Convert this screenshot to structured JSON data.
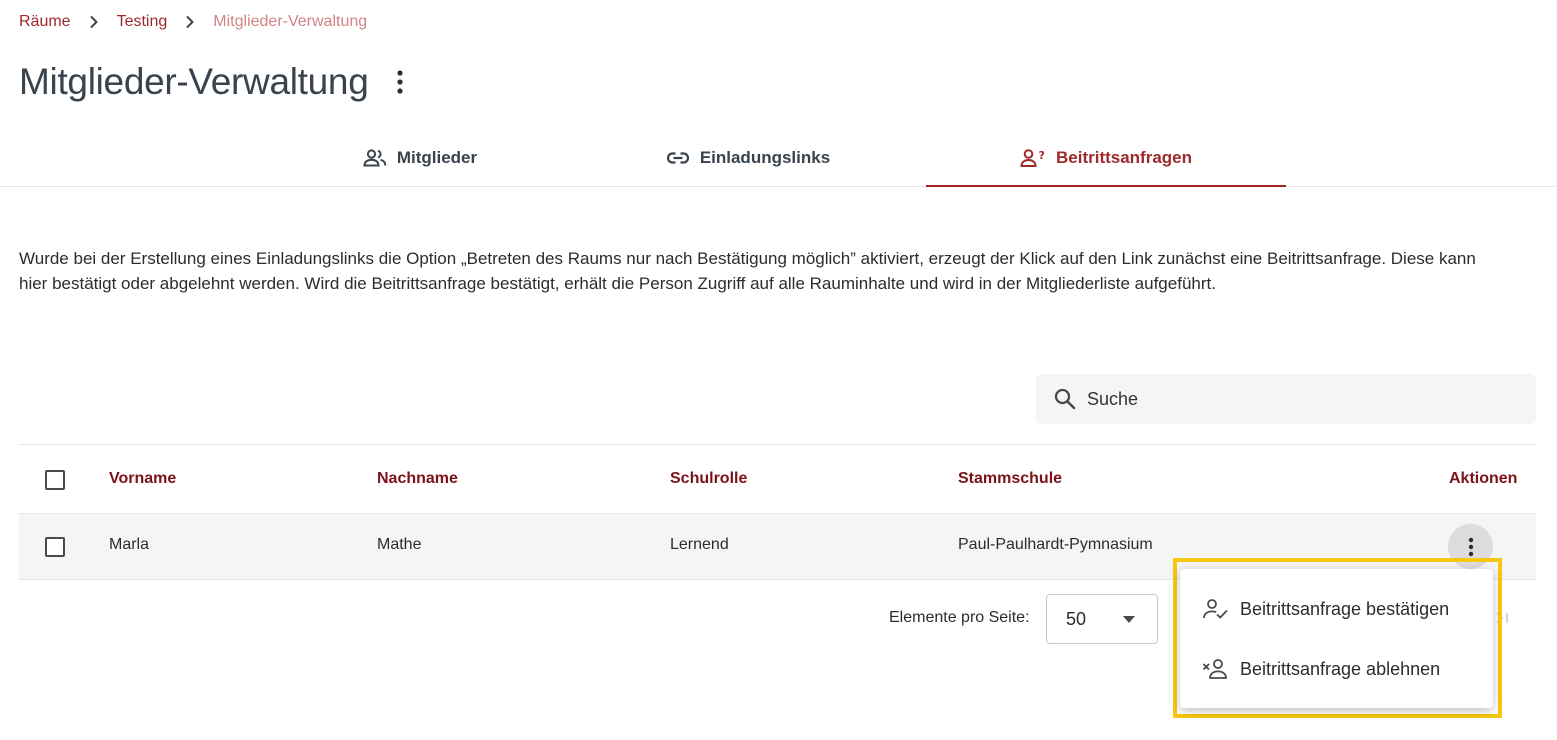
{
  "breadcrumb": {
    "items": [
      "Räume",
      "Testing",
      "Mitglieder-Verwaltung"
    ]
  },
  "page": {
    "title": "Mitglieder-Verwaltung"
  },
  "tabs": [
    {
      "label": "Mitglieder",
      "icon": "people-icon",
      "active": false
    },
    {
      "label": "Einladungslinks",
      "icon": "link-icon",
      "active": false
    },
    {
      "label": "Beitrittsanfragen",
      "icon": "person-question-icon",
      "active": true
    }
  ],
  "info": {
    "text": "Wurde bei der Erstellung eines Einladungslinks die Option „Betreten des Raums nur nach Bestätigung möglich” aktiviert, erzeugt der Klick auf den Link zunächst eine Beitrittsanfrage. Diese kann hier bestätigt oder abgelehnt werden. Wird die Beitrittsanfrage bestätigt, erhält die Person Zugriff auf alle Rauminhalte und wird in der Mitgliederliste aufgeführt."
  },
  "search": {
    "placeholder": "Suche"
  },
  "table": {
    "columns": [
      "Vorname",
      "Nachname",
      "Schulrolle",
      "Stammschule",
      "Aktionen"
    ],
    "rows": [
      {
        "vorname": "Marla",
        "nachname": "Mathe",
        "schulrolle": "Lernend",
        "stammschule": "Paul-Paulhardt-Pymnasium"
      }
    ]
  },
  "pagination": {
    "label": "Elemente pro Seite:",
    "per_page": "50"
  },
  "context_menu": {
    "items": [
      {
        "label": "Beitrittsanfrage bestätigen",
        "icon": "person-check-icon"
      },
      {
        "label": "Beitrittsanfrage ablehnen",
        "icon": "person-remove-icon"
      }
    ]
  },
  "colors": {
    "accent": "#9e292b",
    "header_text": "#7a1317",
    "highlight": "#f6c812"
  }
}
